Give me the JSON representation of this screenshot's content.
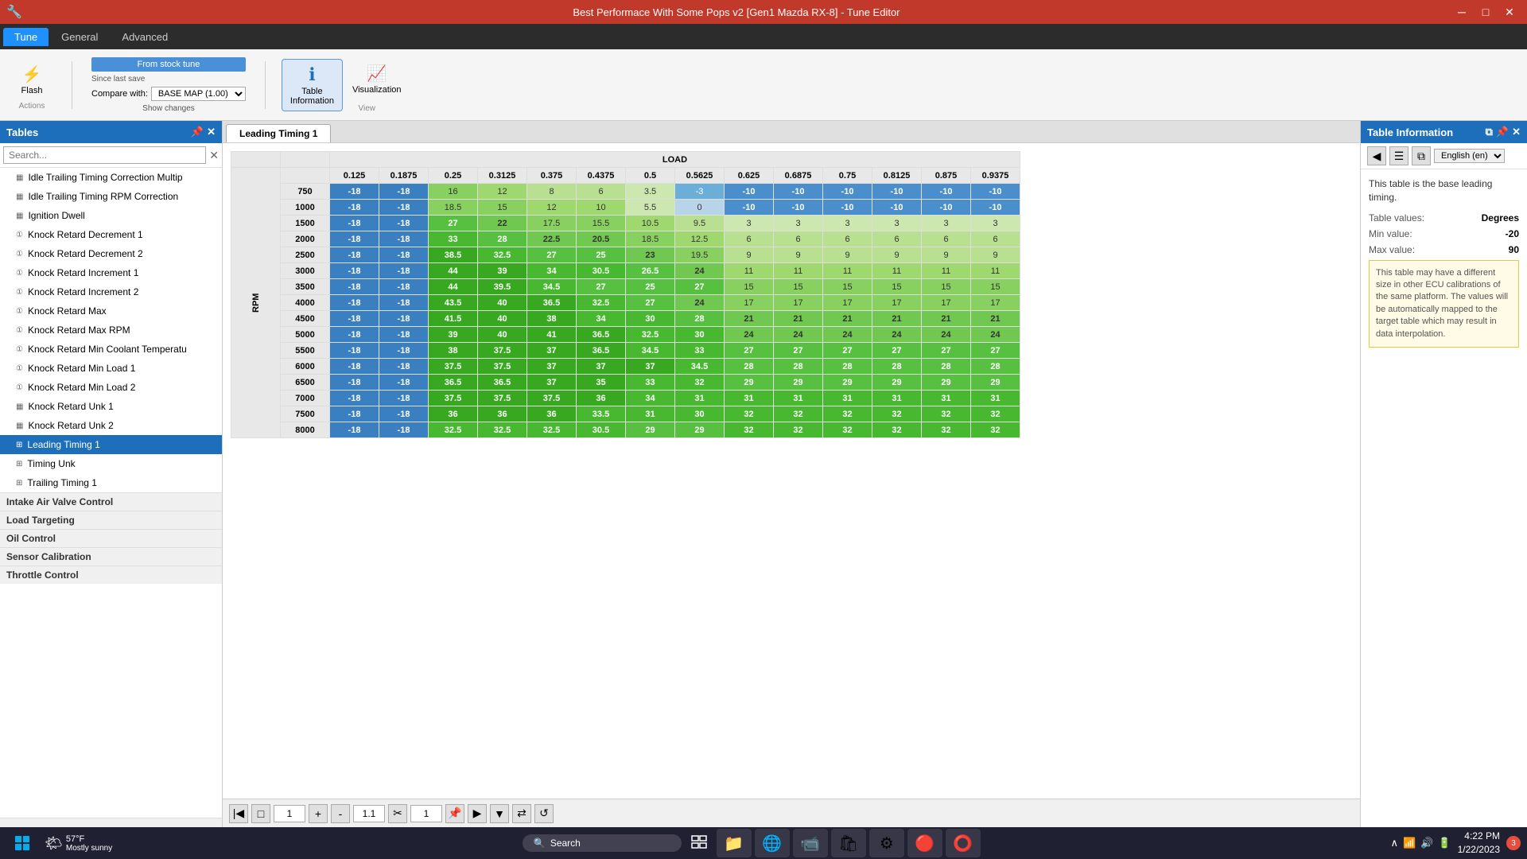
{
  "titlebar": {
    "title": "Best Performace With Some Pops v2 [Gen1 Mazda RX-8] - Tune Editor",
    "icon": "🔧"
  },
  "menubar": {
    "tabs": [
      "Tune",
      "General",
      "Advanced"
    ]
  },
  "toolbar": {
    "flash_label": "Flash",
    "from_stock_label": "From stock tune",
    "since_last_label": "Since last save",
    "compare_label": "Compare with:",
    "compare_value": "BASE MAP (1.00)",
    "show_changes_label": "Show changes",
    "table_info_label": "Table\nInformation",
    "visualization_label": "Visualization",
    "view_label": "View",
    "actions_label": "Actions"
  },
  "sidebar": {
    "title": "Tables",
    "search_placeholder": "Search...",
    "items": [
      {
        "label": "Idle Trailing Timing Correction Multip",
        "type": "table",
        "active": false
      },
      {
        "label": "Idle Trailing Timing RPM Correction",
        "type": "table",
        "active": false
      },
      {
        "label": "Ignition Dwell",
        "type": "table",
        "active": false
      },
      {
        "label": "Knock Retard Decrement 1",
        "type": "value",
        "active": false
      },
      {
        "label": "Knock Retard Decrement 2",
        "type": "value",
        "active": false
      },
      {
        "label": "Knock Retard Increment 1",
        "type": "value",
        "active": false
      },
      {
        "label": "Knock Retard Increment 2",
        "type": "value",
        "active": false
      },
      {
        "label": "Knock Retard Max",
        "type": "value",
        "active": false
      },
      {
        "label": "Knock Retard Max RPM",
        "type": "value",
        "active": false
      },
      {
        "label": "Knock Retard Min Coolant Temperatu",
        "type": "value",
        "active": false
      },
      {
        "label": "Knock Retard Min Load 1",
        "type": "value",
        "active": false
      },
      {
        "label": "Knock Retard Min Load 2",
        "type": "value",
        "active": false
      },
      {
        "label": "Knock Retard Unk 1",
        "type": "table",
        "active": false
      },
      {
        "label": "Knock Retard Unk 2",
        "type": "table",
        "active": false
      },
      {
        "label": "Leading Timing 1",
        "type": "grid",
        "active": true
      },
      {
        "label": "Timing Unk",
        "type": "grid",
        "active": false
      },
      {
        "label": "Trailing Timing 1",
        "type": "grid",
        "active": false
      }
    ],
    "categories": [
      {
        "label": "Intake Air Valve Control",
        "after": 16
      },
      {
        "label": "Load Targeting",
        "after": 17
      },
      {
        "label": "Oil Control",
        "after": 18
      },
      {
        "label": "Sensor Calibration",
        "after": 19
      },
      {
        "label": "Throttle Control",
        "after": 20
      }
    ]
  },
  "active_tab": "Leading Timing 1",
  "table": {
    "title": "Leading Timing 1",
    "row_label": "RPM",
    "col_label": "LOAD",
    "columns": [
      0.125,
      0.1875,
      0.25,
      0.3125,
      0.375,
      0.4375,
      0.5,
      0.5625,
      0.625,
      0.6875,
      0.75,
      0.8125,
      0.875,
      0.9375
    ],
    "rows": [
      {
        "rpm": 750,
        "values": [
          -18,
          -18,
          16,
          12,
          8,
          6,
          3.5,
          -3,
          -10,
          -10,
          -10,
          -10,
          -10,
          -10
        ]
      },
      {
        "rpm": 1000,
        "values": [
          -18,
          -18,
          18.5,
          15,
          12,
          10,
          5.5,
          0,
          -10,
          -10,
          -10,
          -10,
          -10,
          -10
        ]
      },
      {
        "rpm": 1500,
        "values": [
          -18,
          -18,
          27,
          22,
          17.5,
          15.5,
          10.5,
          9.5,
          3,
          3,
          3,
          3,
          3,
          3
        ]
      },
      {
        "rpm": 2000,
        "values": [
          -18,
          -18,
          33,
          28,
          22.5,
          20.5,
          18.5,
          12.5,
          6,
          6,
          6,
          6,
          6,
          6
        ]
      },
      {
        "rpm": 2500,
        "values": [
          -18,
          -18,
          38.5,
          32.5,
          27,
          25,
          23,
          19.5,
          9,
          9,
          9,
          9,
          9,
          9
        ]
      },
      {
        "rpm": 3000,
        "values": [
          -18,
          -18,
          44,
          39,
          34,
          30.5,
          26.5,
          24,
          11,
          11,
          11,
          11,
          11,
          11
        ]
      },
      {
        "rpm": 3500,
        "values": [
          -18,
          -18,
          44,
          39.5,
          34.5,
          27,
          25,
          27,
          15,
          15,
          15,
          15,
          15,
          15
        ]
      },
      {
        "rpm": 4000,
        "values": [
          -18,
          -18,
          43.5,
          40,
          36.5,
          32.5,
          27,
          24,
          17,
          17,
          17,
          17,
          17,
          17
        ]
      },
      {
        "rpm": 4500,
        "values": [
          -18,
          -18,
          41.5,
          40,
          38,
          34,
          30,
          28,
          21,
          21,
          21,
          21,
          21,
          21
        ]
      },
      {
        "rpm": 5000,
        "values": [
          -18,
          -18,
          39,
          40,
          41,
          36.5,
          32.5,
          30,
          24,
          24,
          24,
          24,
          24,
          24
        ]
      },
      {
        "rpm": 5500,
        "values": [
          -18,
          -18,
          38,
          37.5,
          37,
          36.5,
          34.5,
          33,
          27,
          27,
          27,
          27,
          27,
          27
        ]
      },
      {
        "rpm": 6000,
        "values": [
          -18,
          -18,
          37.5,
          37.5,
          37,
          37,
          37,
          34.5,
          28,
          28,
          28,
          28,
          28,
          28
        ]
      },
      {
        "rpm": 6500,
        "values": [
          -18,
          -18,
          36.5,
          36.5,
          37,
          35,
          33,
          32,
          29,
          29,
          29,
          29,
          29,
          29
        ]
      },
      {
        "rpm": 7000,
        "values": [
          -18,
          -18,
          37.5,
          37.5,
          37.5,
          36,
          34,
          31,
          31,
          31,
          31,
          31,
          31,
          31
        ]
      },
      {
        "rpm": 7500,
        "values": [
          -18,
          -18,
          36,
          36,
          36,
          33.5,
          31,
          30,
          32,
          32,
          32,
          32,
          32,
          32
        ]
      },
      {
        "rpm": 8000,
        "values": [
          -18,
          -18,
          32.5,
          32.5,
          32.5,
          30.5,
          29,
          29,
          32,
          32,
          32,
          32,
          32,
          32
        ]
      }
    ]
  },
  "table_info": {
    "title": "Table Information",
    "description": "This table is the base leading timing.",
    "values_label": "Table values:",
    "values": "Degrees",
    "min_label": "Min value:",
    "min": "-20",
    "max_label": "Max value:",
    "max": "90",
    "warning": "This table may have a different size in other ECU calibrations of the same platform. The values will be automatically mapped to the target table which may result in data interpolation.",
    "language_label": "English (en)"
  },
  "bottom_toolbar": {
    "page_input": "1",
    "zoom_input": "1.1",
    "scale_input": "1"
  },
  "taskbar": {
    "weather_temp": "57°F",
    "weather_desc": "Mostly sunny",
    "search_label": "Search",
    "time": "4:22 PM",
    "date": "1/22/2023",
    "notification_count": "3"
  }
}
